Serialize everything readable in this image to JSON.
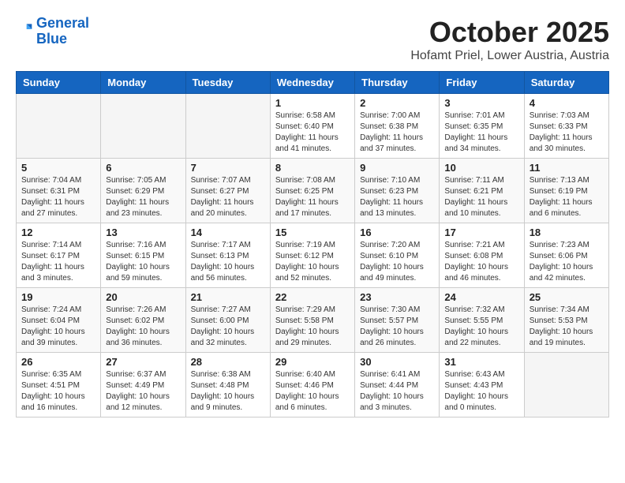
{
  "header": {
    "logo_line1": "General",
    "logo_line2": "Blue",
    "month": "October 2025",
    "location": "Hofamt Priel, Lower Austria, Austria"
  },
  "weekdays": [
    "Sunday",
    "Monday",
    "Tuesday",
    "Wednesday",
    "Thursday",
    "Friday",
    "Saturday"
  ],
  "weeks": [
    [
      {
        "day": "",
        "info": ""
      },
      {
        "day": "",
        "info": ""
      },
      {
        "day": "",
        "info": ""
      },
      {
        "day": "1",
        "info": "Sunrise: 6:58 AM\nSunset: 6:40 PM\nDaylight: 11 hours\nand 41 minutes."
      },
      {
        "day": "2",
        "info": "Sunrise: 7:00 AM\nSunset: 6:38 PM\nDaylight: 11 hours\nand 37 minutes."
      },
      {
        "day": "3",
        "info": "Sunrise: 7:01 AM\nSunset: 6:35 PM\nDaylight: 11 hours\nand 34 minutes."
      },
      {
        "day": "4",
        "info": "Sunrise: 7:03 AM\nSunset: 6:33 PM\nDaylight: 11 hours\nand 30 minutes."
      }
    ],
    [
      {
        "day": "5",
        "info": "Sunrise: 7:04 AM\nSunset: 6:31 PM\nDaylight: 11 hours\nand 27 minutes."
      },
      {
        "day": "6",
        "info": "Sunrise: 7:05 AM\nSunset: 6:29 PM\nDaylight: 11 hours\nand 23 minutes."
      },
      {
        "day": "7",
        "info": "Sunrise: 7:07 AM\nSunset: 6:27 PM\nDaylight: 11 hours\nand 20 minutes."
      },
      {
        "day": "8",
        "info": "Sunrise: 7:08 AM\nSunset: 6:25 PM\nDaylight: 11 hours\nand 17 minutes."
      },
      {
        "day": "9",
        "info": "Sunrise: 7:10 AM\nSunset: 6:23 PM\nDaylight: 11 hours\nand 13 minutes."
      },
      {
        "day": "10",
        "info": "Sunrise: 7:11 AM\nSunset: 6:21 PM\nDaylight: 11 hours\nand 10 minutes."
      },
      {
        "day": "11",
        "info": "Sunrise: 7:13 AM\nSunset: 6:19 PM\nDaylight: 11 hours\nand 6 minutes."
      }
    ],
    [
      {
        "day": "12",
        "info": "Sunrise: 7:14 AM\nSunset: 6:17 PM\nDaylight: 11 hours\nand 3 minutes."
      },
      {
        "day": "13",
        "info": "Sunrise: 7:16 AM\nSunset: 6:15 PM\nDaylight: 10 hours\nand 59 minutes."
      },
      {
        "day": "14",
        "info": "Sunrise: 7:17 AM\nSunset: 6:13 PM\nDaylight: 10 hours\nand 56 minutes."
      },
      {
        "day": "15",
        "info": "Sunrise: 7:19 AM\nSunset: 6:12 PM\nDaylight: 10 hours\nand 52 minutes."
      },
      {
        "day": "16",
        "info": "Sunrise: 7:20 AM\nSunset: 6:10 PM\nDaylight: 10 hours\nand 49 minutes."
      },
      {
        "day": "17",
        "info": "Sunrise: 7:21 AM\nSunset: 6:08 PM\nDaylight: 10 hours\nand 46 minutes."
      },
      {
        "day": "18",
        "info": "Sunrise: 7:23 AM\nSunset: 6:06 PM\nDaylight: 10 hours\nand 42 minutes."
      }
    ],
    [
      {
        "day": "19",
        "info": "Sunrise: 7:24 AM\nSunset: 6:04 PM\nDaylight: 10 hours\nand 39 minutes."
      },
      {
        "day": "20",
        "info": "Sunrise: 7:26 AM\nSunset: 6:02 PM\nDaylight: 10 hours\nand 36 minutes."
      },
      {
        "day": "21",
        "info": "Sunrise: 7:27 AM\nSunset: 6:00 PM\nDaylight: 10 hours\nand 32 minutes."
      },
      {
        "day": "22",
        "info": "Sunrise: 7:29 AM\nSunset: 5:58 PM\nDaylight: 10 hours\nand 29 minutes."
      },
      {
        "day": "23",
        "info": "Sunrise: 7:30 AM\nSunset: 5:57 PM\nDaylight: 10 hours\nand 26 minutes."
      },
      {
        "day": "24",
        "info": "Sunrise: 7:32 AM\nSunset: 5:55 PM\nDaylight: 10 hours\nand 22 minutes."
      },
      {
        "day": "25",
        "info": "Sunrise: 7:34 AM\nSunset: 5:53 PM\nDaylight: 10 hours\nand 19 minutes."
      }
    ],
    [
      {
        "day": "26",
        "info": "Sunrise: 6:35 AM\nSunset: 4:51 PM\nDaylight: 10 hours\nand 16 minutes."
      },
      {
        "day": "27",
        "info": "Sunrise: 6:37 AM\nSunset: 4:49 PM\nDaylight: 10 hours\nand 12 minutes."
      },
      {
        "day": "28",
        "info": "Sunrise: 6:38 AM\nSunset: 4:48 PM\nDaylight: 10 hours\nand 9 minutes."
      },
      {
        "day": "29",
        "info": "Sunrise: 6:40 AM\nSunset: 4:46 PM\nDaylight: 10 hours\nand 6 minutes."
      },
      {
        "day": "30",
        "info": "Sunrise: 6:41 AM\nSunset: 4:44 PM\nDaylight: 10 hours\nand 3 minutes."
      },
      {
        "day": "31",
        "info": "Sunrise: 6:43 AM\nSunset: 4:43 PM\nDaylight: 10 hours\nand 0 minutes."
      },
      {
        "day": "",
        "info": ""
      }
    ]
  ]
}
